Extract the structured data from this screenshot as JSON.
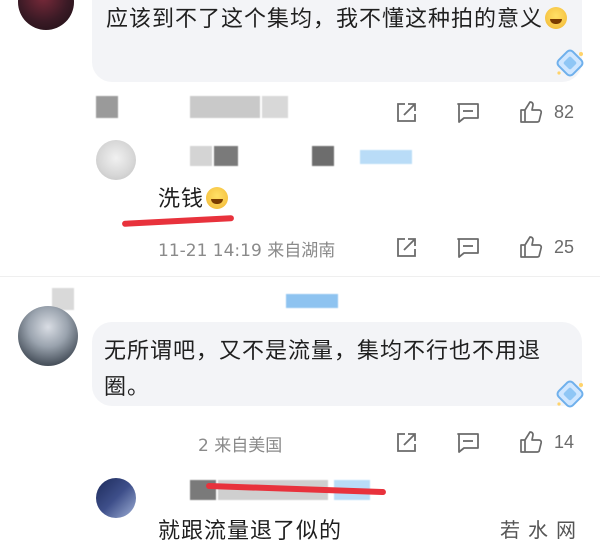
{
  "comments": [
    {
      "text": "应该到不了这个集均，我不懂这种拍的意义",
      "likes": "82"
    },
    {
      "text": "洗钱",
      "time_location": "11-21 14:19 来自湖南",
      "likes": "25"
    },
    {
      "text": "无所谓吧，又不是流量，集均不行也不用退圈。",
      "meta_partial": "2 来自美国",
      "likes": "14"
    },
    {
      "text": "就跟流量退了似的"
    }
  ],
  "watermark": "若水网",
  "colors": {
    "bubble_bg": "#f3f4f7",
    "red_annotation": "#e8323c",
    "meta_gray": "#8a8a8a",
    "mask_blue": "#8ec3f0"
  },
  "icons": [
    "share-icon",
    "comment-icon",
    "like-icon",
    "vip-diamond-icon",
    "laugh-emoji"
  ]
}
